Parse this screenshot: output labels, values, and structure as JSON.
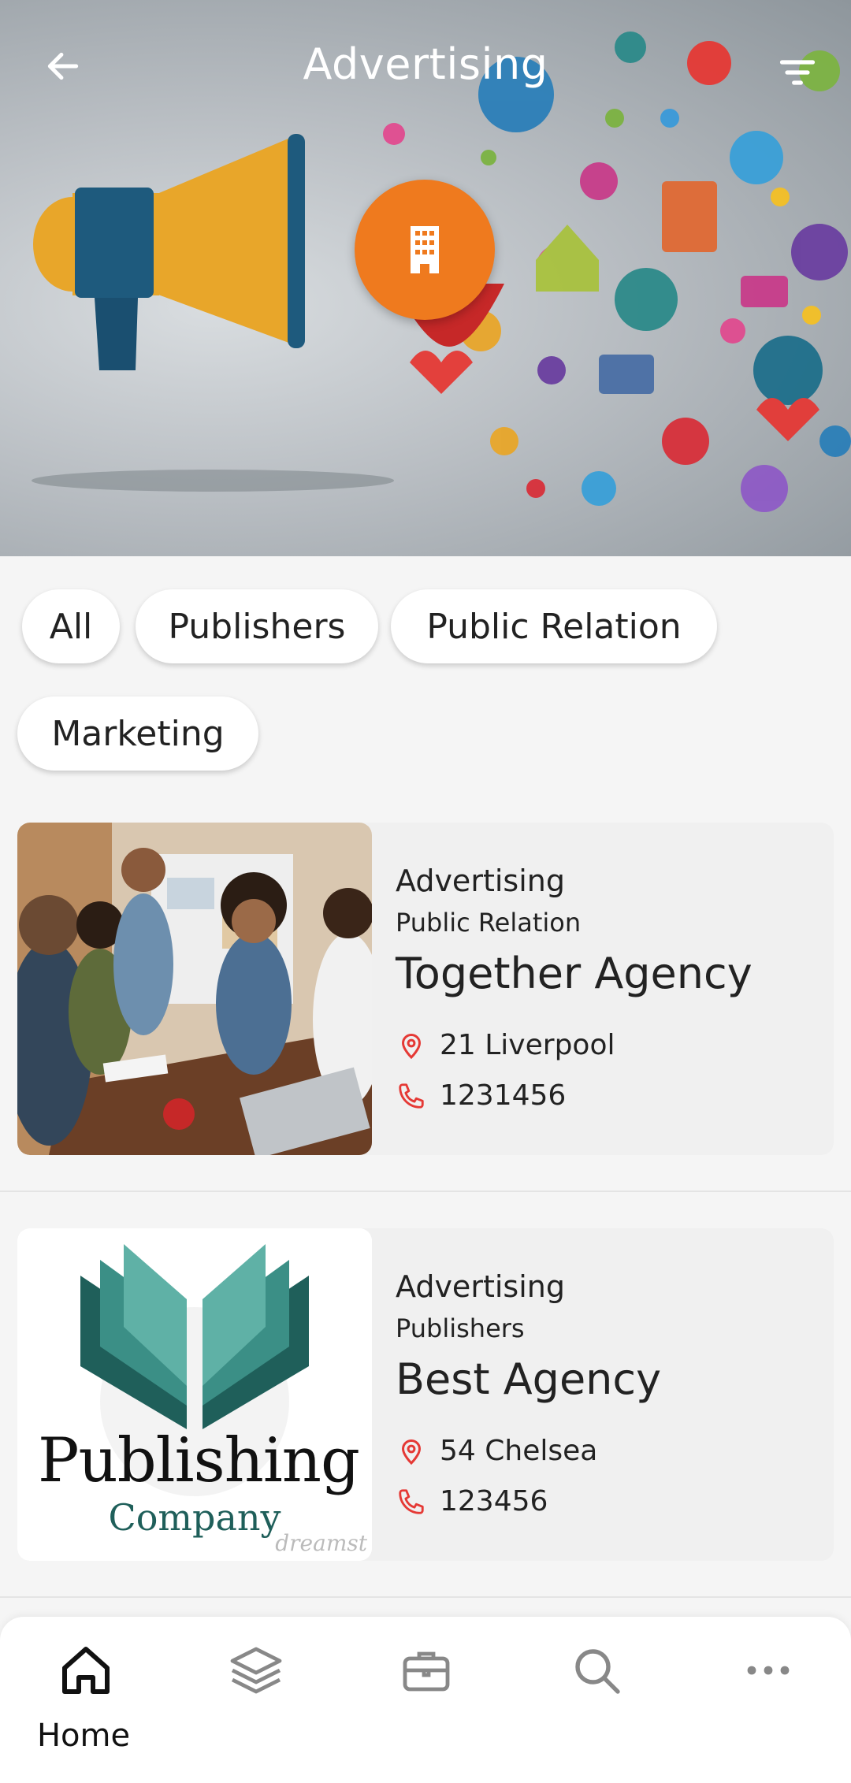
{
  "header": {
    "title": "Advertising",
    "back_icon": "arrow-left-icon",
    "filter_icon": "filter-icon",
    "badge_icon": "building-icon"
  },
  "filters": {
    "chips": [
      "All",
      "Publishers",
      "Public Relation",
      "Marketing"
    ]
  },
  "listings": [
    {
      "category": "Advertising",
      "subcategory": "Public Relation",
      "name": "Together Agency",
      "address": "21 Liverpool",
      "phone": "1231456"
    },
    {
      "category": "Advertising",
      "subcategory": "Publishers",
      "name": "Best Agency",
      "address": "54 Chelsea",
      "phone": "123456",
      "logo_text_1": "Publishing",
      "logo_text_2": "Company",
      "watermark": "dreamst"
    }
  ],
  "bottom_nav": {
    "items": [
      {
        "label": "Home",
        "icon": "home-icon"
      },
      {
        "label": "",
        "icon": "layers-icon"
      },
      {
        "label": "",
        "icon": "briefcase-icon"
      },
      {
        "label": "",
        "icon": "search-icon"
      },
      {
        "label": "",
        "icon": "more-icon"
      }
    ]
  },
  "colors": {
    "accent": "#ef7a1e",
    "icon_red": "#e53935",
    "text": "#222222"
  }
}
